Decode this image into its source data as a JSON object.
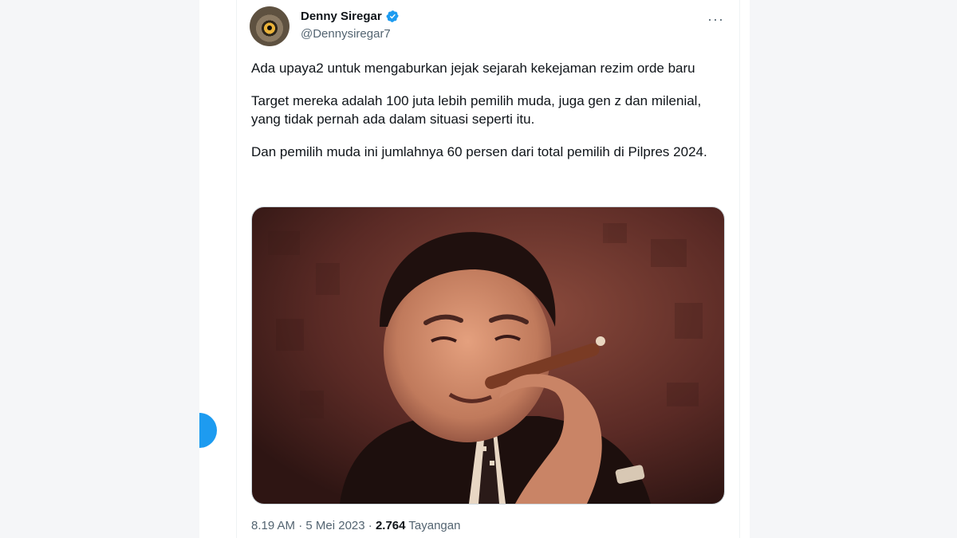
{
  "author": {
    "display_name": "Denny Siregar",
    "handle": "@Dennysiregar7",
    "verified": true
  },
  "tweet": {
    "paragraphs": [
      "Ada upaya2 untuk mengaburkan jejak sejarah kekejaman rezim orde baru",
      "Target mereka adalah 100 juta lebih pemilih muda, juga gen z dan milenial, yang tidak pernah ada dalam situasi seperti itu.",
      "Dan pemilih muda ini jumlahnya 60 persen dari total pemilih di Pilpres 2024."
    ],
    "media": {
      "subject": "sepia-toned portrait photo of a man smoking a cigar"
    }
  },
  "meta": {
    "time": "8.19 AM",
    "sep1": "·",
    "date": "5 Mei 2023",
    "sep2": "·",
    "views_count": "2.764",
    "views_label": "Tayangan"
  },
  "icons": {
    "more": "more-options-icon",
    "verified": "verified-badge-icon"
  },
  "colors": {
    "accent": "#1d9bf0",
    "text_primary": "#0f1419",
    "text_secondary": "#536471"
  }
}
